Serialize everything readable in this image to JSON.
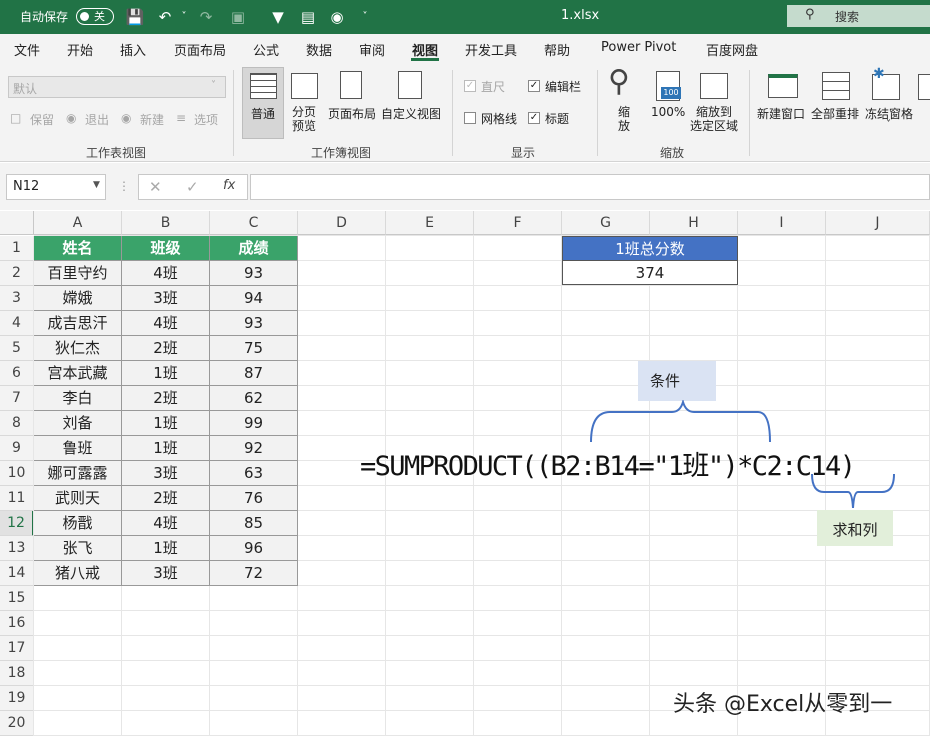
{
  "titlebar": {
    "autosave_label": "自动保存",
    "autosave_state": "关",
    "filename": "1.xlsx",
    "search": "搜索"
  },
  "menu": {
    "items": [
      "文件",
      "开始",
      "插入",
      "页面布局",
      "公式",
      "数据",
      "审阅",
      "视图",
      "开发工具",
      "帮助",
      "Power Pivot",
      "百度网盘"
    ],
    "active": "视图"
  },
  "ribbon": {
    "sheet_view": {
      "dropdown": "默认",
      "keep": "保留",
      "exit": "退出",
      "new": "新建",
      "options": "选项",
      "label": "工作表视图"
    },
    "workbook_view": {
      "normal": "普通",
      "page_break": "分页\n预览",
      "page_layout": "页面布局",
      "custom": "自定义视图",
      "label": "工作簿视图"
    },
    "show": {
      "ruler": "直尺",
      "formula_bar": "编辑栏",
      "gridlines": "网格线",
      "headings": "标题",
      "label": "显示"
    },
    "zoom": {
      "zoom": "缩\n放",
      "pct": "100%",
      "pct_icon": "100",
      "to_selection": "缩放到\n选定区域",
      "label": "缩放"
    },
    "window": {
      "new_window": "新建窗口",
      "arrange_all": "全部重排",
      "freeze": "冻结窗格"
    }
  },
  "formula_bar": {
    "name_box": "N12",
    "formula": ""
  },
  "columns": [
    "A",
    "B",
    "C",
    "D",
    "E",
    "F",
    "G",
    "H",
    "I",
    "J"
  ],
  "rows": [
    "1",
    "2",
    "3",
    "4",
    "5",
    "6",
    "7",
    "8",
    "9",
    "10",
    "11",
    "12",
    "13",
    "14",
    "15",
    "16",
    "17",
    "18",
    "19",
    "20"
  ],
  "table": {
    "headers": [
      "姓名",
      "班级",
      "成绩"
    ],
    "rows": [
      [
        "百里守约",
        "4班",
        "93"
      ],
      [
        "嫦娥",
        "3班",
        "94"
      ],
      [
        "成吉思汗",
        "4班",
        "93"
      ],
      [
        "狄仁杰",
        "2班",
        "75"
      ],
      [
        "宫本武藏",
        "1班",
        "87"
      ],
      [
        "李白",
        "2班",
        "62"
      ],
      [
        "刘备",
        "1班",
        "99"
      ],
      [
        "鲁班",
        "1班",
        "92"
      ],
      [
        "娜可露露",
        "3班",
        "63"
      ],
      [
        "武则天",
        "2班",
        "76"
      ],
      [
        "杨戬",
        "4班",
        "85"
      ],
      [
        "张飞",
        "1班",
        "96"
      ],
      [
        "猪八戒",
        "3班",
        "72"
      ]
    ]
  },
  "summary": {
    "header": "1班总分数",
    "value": "374"
  },
  "annotation": {
    "formula": "=SUMPRODUCT((B2:B14=\"1班\")*C2:C14)",
    "condition": "条件",
    "sum_column": "求和列"
  },
  "watermark": "头条 @Excel从零到一",
  "colors": {
    "excel_green": "#217346",
    "table_header": "#3aa36a",
    "summary_header": "#4472c4"
  }
}
